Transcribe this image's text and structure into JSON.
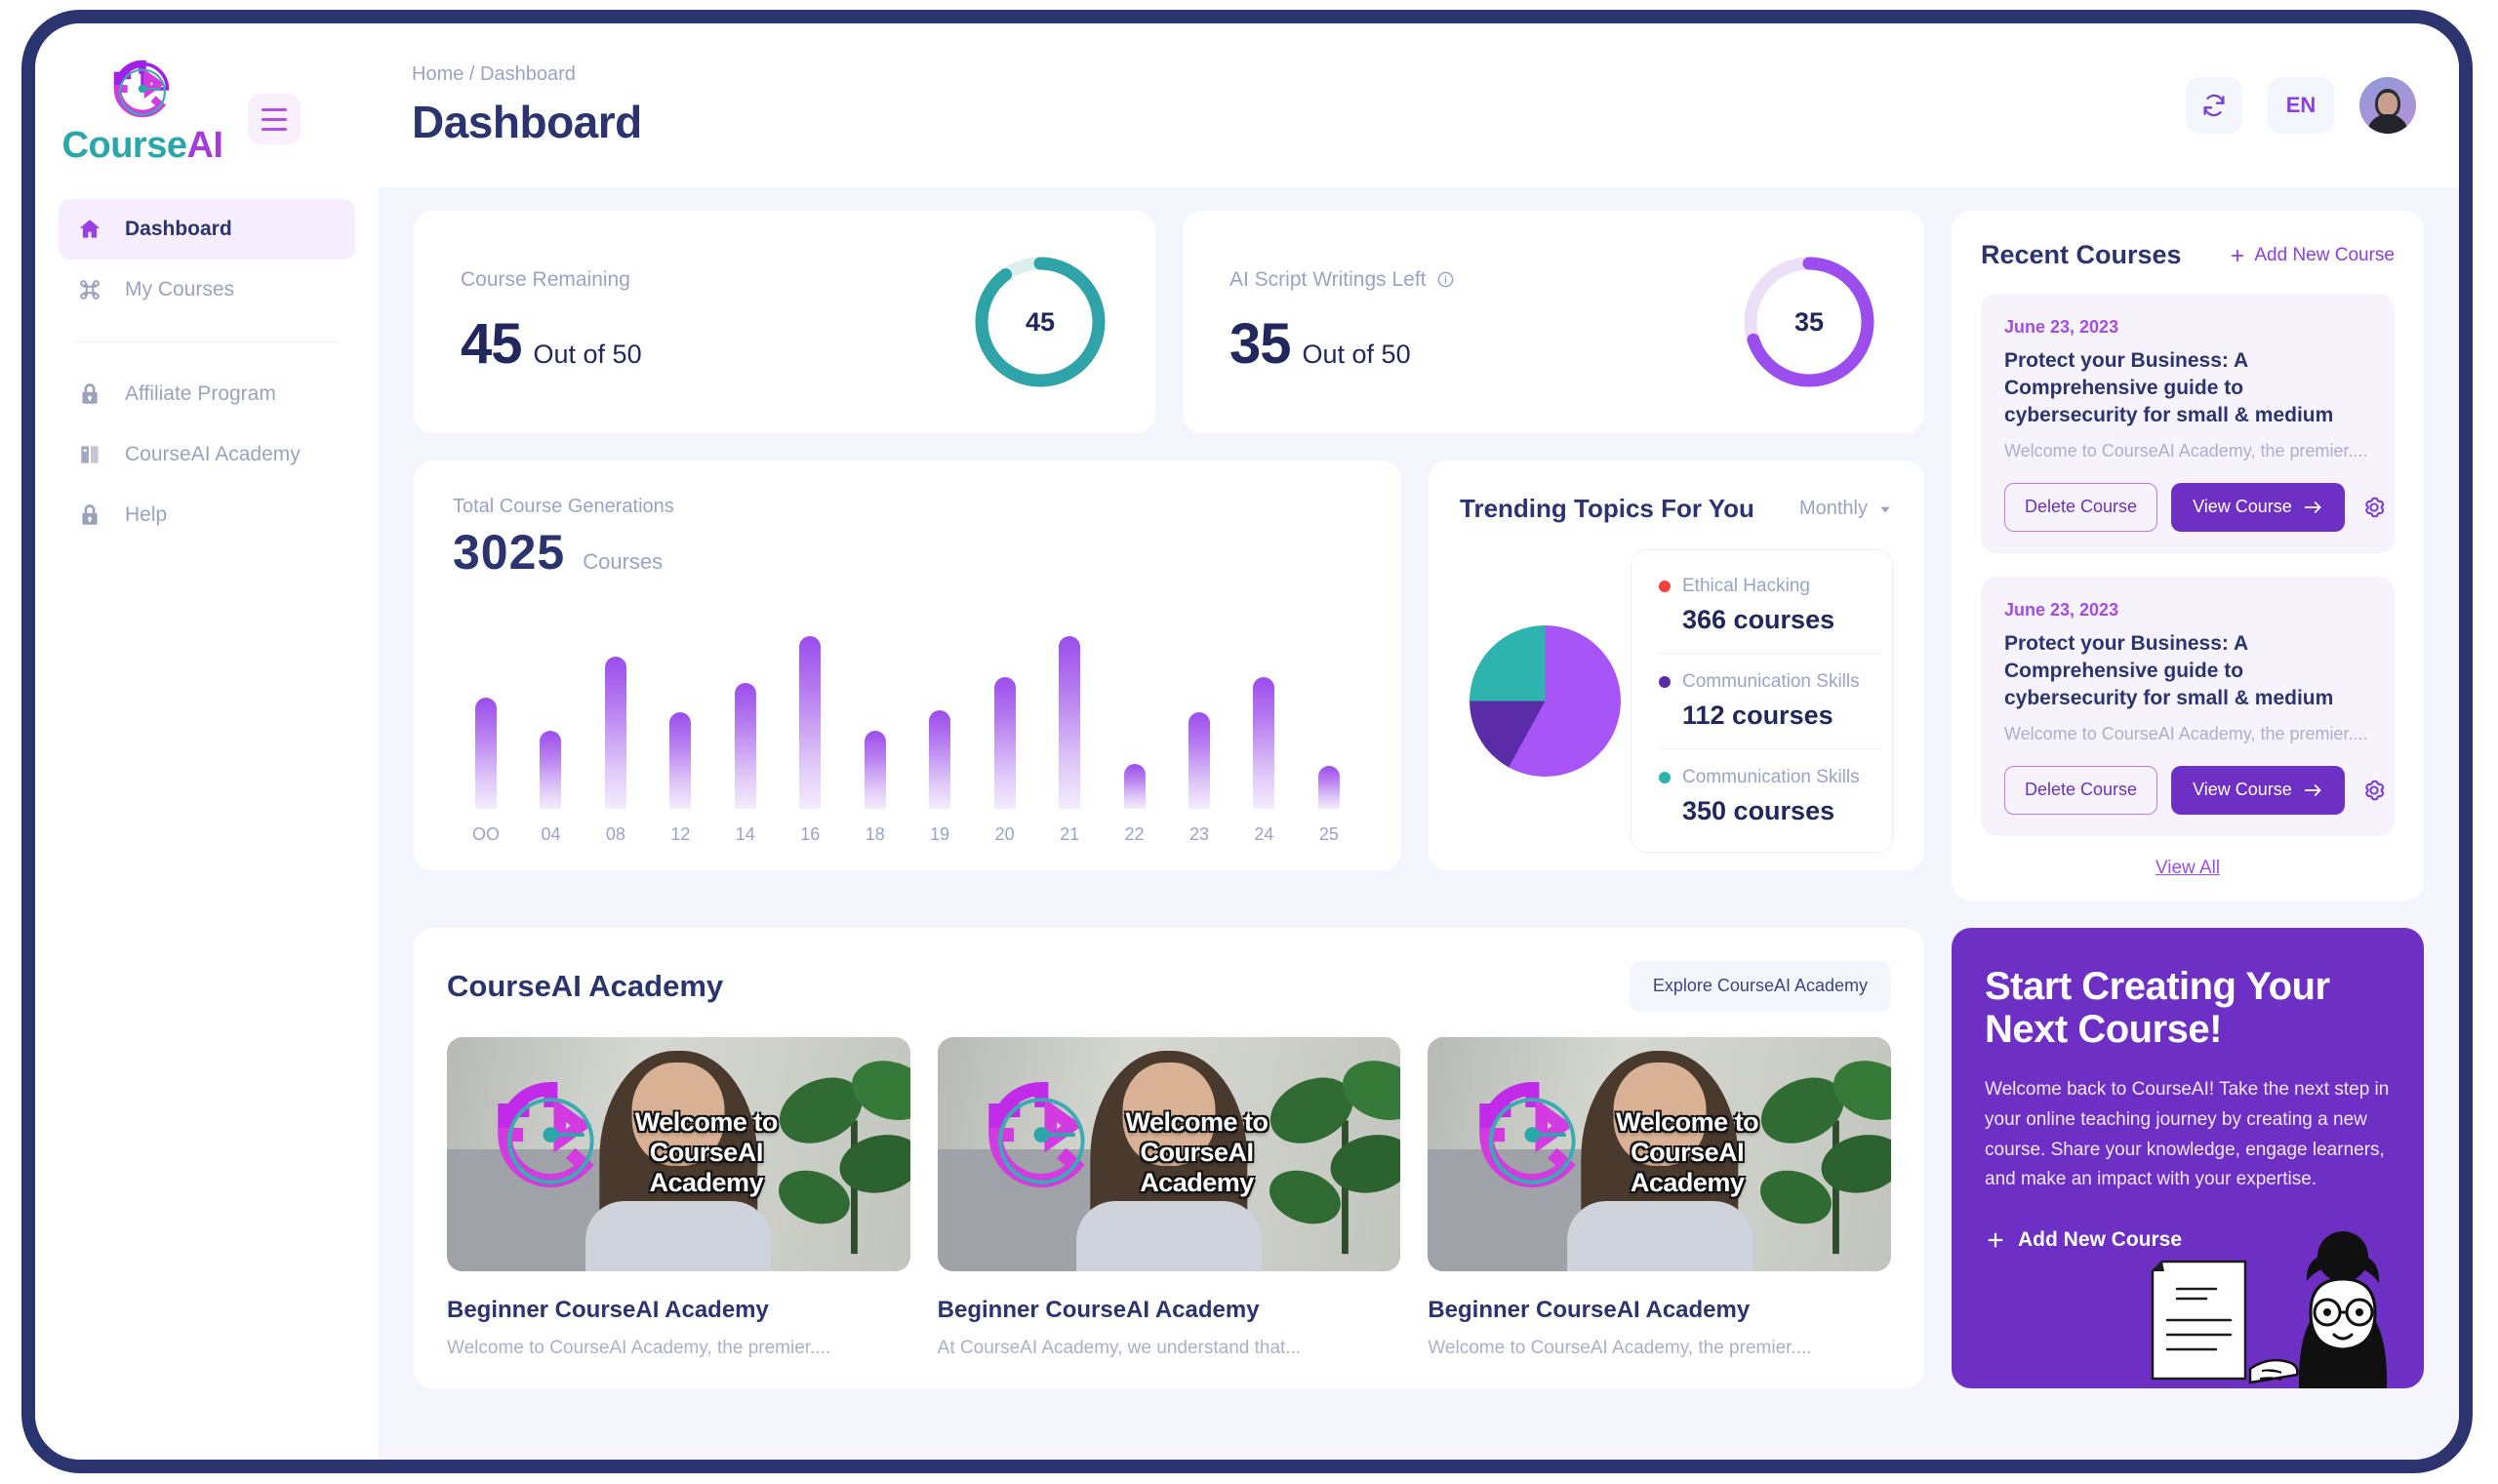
{
  "brand": {
    "name_part1": "Course",
    "name_part2": "AI"
  },
  "sidebar": {
    "items": [
      {
        "label": "Dashboard",
        "icon": "home-icon"
      },
      {
        "label": "My Courses",
        "icon": "courses-icon"
      },
      {
        "label": "Affiliate Program",
        "icon": "lock-icon"
      },
      {
        "label": "CourseAI Academy",
        "icon": "book-icon"
      },
      {
        "label": "Help",
        "icon": "lock-icon"
      }
    ]
  },
  "topbar": {
    "breadcrumb": "Home / Dashboard",
    "title": "Dashboard",
    "refresh_icon": "refresh-icon",
    "language": "EN"
  },
  "stats": [
    {
      "label": "Course Remaining",
      "value": "45",
      "out_of": "Out of 50",
      "ring_value": "45",
      "percent": 90,
      "color": "#2fa3a8",
      "track": "#ddeeef",
      "has_info": false
    },
    {
      "label": "AI Script Writings Left",
      "value": "35",
      "out_of": "Out of 50",
      "ring_value": "35",
      "percent": 70,
      "color": "#9b4ded",
      "track": "#ece0f8",
      "has_info": true
    }
  ],
  "generations": {
    "label": "Total Course Generations",
    "value": "3025",
    "unit": "Courses"
  },
  "trending": {
    "title": "Trending Topics For You",
    "period": "Monthly",
    "legend": [
      {
        "name": "Ethical Hacking",
        "count": "366 courses",
        "color": "#f04438"
      },
      {
        "name": "Communication Skills",
        "count": "112 courses",
        "color": "#5b2ca8"
      },
      {
        "name": "Communication Skills",
        "count": "350 courses",
        "color": "#2fb3ae"
      }
    ]
  },
  "recent": {
    "title": "Recent Courses",
    "add_label": "Add New Course",
    "view_all": "View All",
    "courses": [
      {
        "date": "June 23, 2023",
        "name": "Protect your Business: A Comprehensive guide to cybersecurity for small & medium",
        "desc": "Welcome to CourseAI Academy, the premier....",
        "delete_label": "Delete Course",
        "view_label": "View Course"
      },
      {
        "date": "June 23, 2023",
        "name": "Protect your Business: A Comprehensive guide to cybersecurity for small & medium",
        "desc": "Welcome to CourseAI Academy, the premier....",
        "delete_label": "Delete Course",
        "view_label": "View Course"
      }
    ]
  },
  "academy": {
    "title": "CourseAI Academy",
    "explore_label": "Explore CourseAI Academy",
    "thumb_overlay": "Welcome to CourseAI Academy",
    "items": [
      {
        "name": "Beginner CourseAI Academy",
        "desc": "Welcome to CourseAI Academy, the premier...."
      },
      {
        "name": "Beginner CourseAI Academy",
        "desc": "At CourseAI Academy, we understand that..."
      },
      {
        "name": "Beginner CourseAI Academy",
        "desc": "Welcome to CourseAI Academy, the premier...."
      }
    ]
  },
  "cta": {
    "title": "Start Creating Your Next Course!",
    "desc": "Welcome back to CourseAI! Take the next step in your online teaching journey by creating a new course. Share your knowledge, engage learners, and make an impact with your expertise.",
    "add_label": "Add New Course"
  },
  "chart_data": [
    {
      "type": "bar",
      "title": "Total Course Generations",
      "categories": [
        "OO",
        "04",
        "08",
        "12",
        "14",
        "16",
        "18",
        "19",
        "20",
        "21",
        "22",
        "23",
        "24",
        "25"
      ],
      "values": [
        60,
        42,
        82,
        52,
        68,
        93,
        42,
        53,
        71,
        93,
        24,
        52,
        71,
        23
      ],
      "xlabel": "",
      "ylabel": "",
      "ylim": [
        0,
        100
      ],
      "grid": false,
      "legend": "none"
    },
    {
      "type": "pie",
      "title": "Trending Topics For You",
      "categories": [
        "Ethical Hacking",
        "Communication Skills",
        "Communication Skills"
      ],
      "values": [
        366,
        112,
        350
      ],
      "slice_percents": [
        58,
        17,
        25
      ],
      "colors": [
        "#a855f7",
        "#5b2ca8",
        "#2fb3ae"
      ],
      "legend": "right"
    },
    {
      "type": "pie",
      "title": "Course Remaining",
      "categories": [
        "Used",
        "Remaining"
      ],
      "values": [
        45,
        5
      ],
      "ylim": [
        0,
        50
      ],
      "colors": [
        "#2fa3a8",
        "#ddeeef"
      ],
      "legend": "none"
    },
    {
      "type": "pie",
      "title": "AI Script Writings Left",
      "categories": [
        "Used",
        "Remaining"
      ],
      "values": [
        35,
        15
      ],
      "ylim": [
        0,
        50
      ],
      "colors": [
        "#9b4ded",
        "#ece0f8"
      ],
      "legend": "none"
    }
  ]
}
